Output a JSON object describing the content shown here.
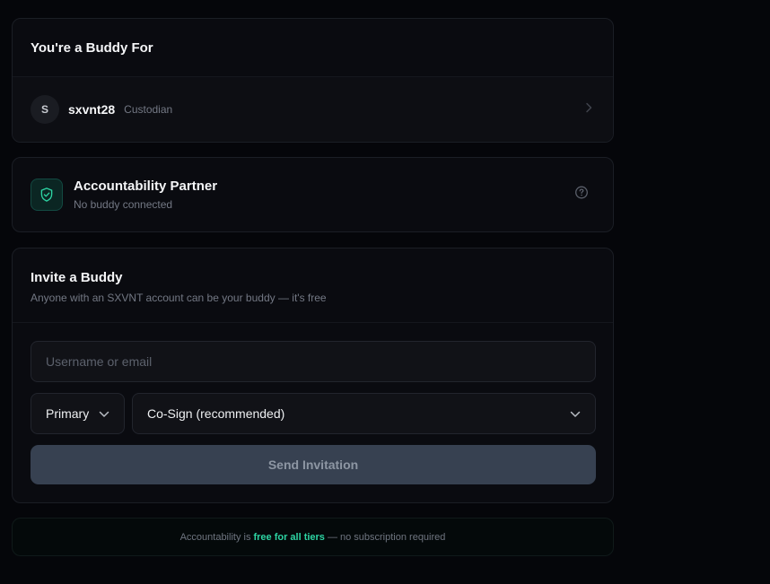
{
  "buddy_for": {
    "title": "You're a Buddy For",
    "buddy": {
      "avatar_initial": "S",
      "name": "sxvnt28",
      "role": "Custodian"
    },
    "chevron_icon": "chevron-right-icon"
  },
  "partner": {
    "icon": "shield-check-icon",
    "title": "Accountability Partner",
    "status": "No buddy connected",
    "help_icon": "help-circle-icon"
  },
  "invite": {
    "title": "Invite a Buddy",
    "subtitle": "Anyone with an SXVNT account can be your buddy — it's free",
    "username": {
      "placeholder": "Username or email",
      "value": ""
    },
    "role_select": {
      "selected": "Primary",
      "icon": "chevron-down-icon"
    },
    "mode_select": {
      "selected": "Co-Sign (recommended)",
      "icon": "chevron-down-icon"
    },
    "send_label": "Send Invitation"
  },
  "footer": {
    "prefix": "Accountability is",
    "highlight": "free for all tiers",
    "suffix": "— no subscription required"
  },
  "colors": {
    "accent": "#2dd4a3",
    "background": "#05060a",
    "card": "#0a0b10",
    "button_disabled": "#374151"
  }
}
